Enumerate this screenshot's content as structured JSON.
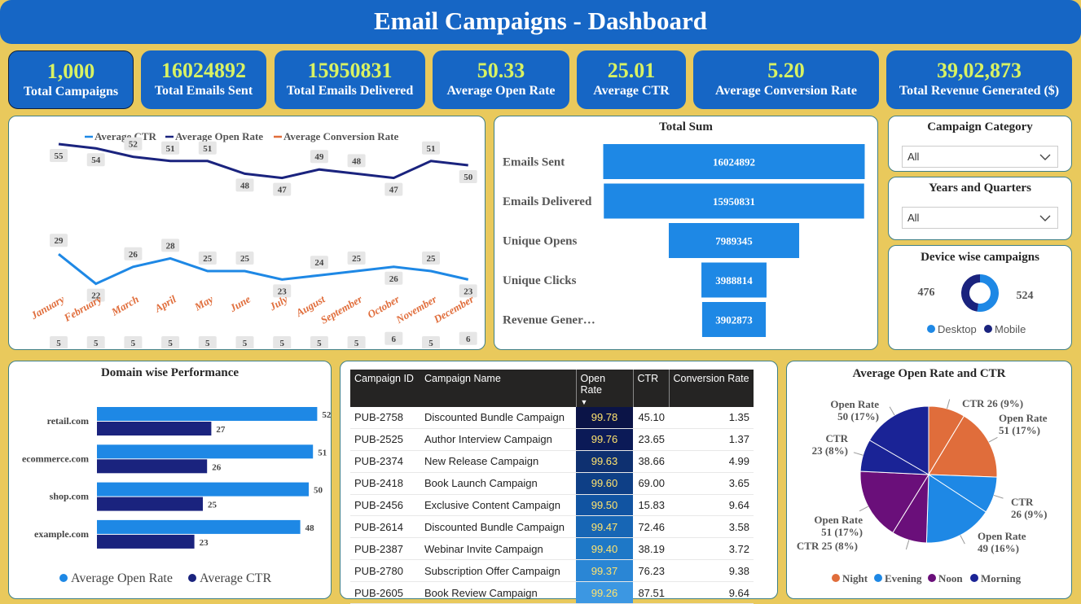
{
  "title": "Email Campaigns - Dashboard",
  "kpis": [
    {
      "value": "1,000",
      "label": "Total Campaigns"
    },
    {
      "value": "16024892",
      "label": "Total Emails Sent"
    },
    {
      "value": "15950831",
      "label": "Total Emails Delivered"
    },
    {
      "value": "50.33",
      "label": "Average Open Rate"
    },
    {
      "value": "25.01",
      "label": "Average CTR"
    },
    {
      "value": "5.20",
      "label": "Average Conversion Rate"
    },
    {
      "value": "39,02,873",
      "label": "Total Revenue Generated ($)"
    }
  ],
  "colors": {
    "primary": "#1666C5",
    "kpi_value": "#D8F263",
    "background": "#E9C95C",
    "ctr": "#1E88E5",
    "open_rate": "#1A237E",
    "conversion": "#E06D3B"
  },
  "chart_data": [
    {
      "type": "line",
      "categories": [
        "January",
        "February",
        "March",
        "April",
        "May",
        "June",
        "July",
        "August",
        "September",
        "October",
        "November",
        "December"
      ],
      "series": [
        {
          "name": "Average CTR",
          "values": [
            29,
            22,
            26,
            28,
            25,
            25,
            23,
            24,
            25,
            26,
            25,
            23
          ]
        },
        {
          "name": "Average Open Rate",
          "values": [
            55,
            54,
            52,
            51,
            51,
            48,
            47,
            49,
            48,
            47,
            51,
            50
          ]
        },
        {
          "name": "Average Conversion Rate",
          "values": [
            5,
            5,
            5,
            5,
            5,
            5,
            5,
            5,
            5,
            6,
            5,
            6
          ]
        }
      ],
      "legend": "top",
      "grid": false
    },
    {
      "type": "bar",
      "title": "Total Sum",
      "categories": [
        "Emails Sent",
        "Emails Delivered",
        "Unique Opens",
        "Unique Clicks",
        "Revenue Gener…"
      ],
      "values": [
        16024892,
        15950831,
        7989345,
        3988814,
        3902873
      ]
    },
    {
      "type": "bar",
      "title": "Domain wise Performance",
      "categories": [
        "retail.com",
        "ecommerce.com",
        "shop.com",
        "example.com"
      ],
      "series": [
        {
          "name": "Average Open Rate",
          "values": [
            52,
            51,
            50,
            48
          ]
        },
        {
          "name": "Average CTR",
          "values": [
            27,
            26,
            25,
            23
          ]
        }
      ],
      "legend": "bottom"
    },
    {
      "type": "pie",
      "title": "Device wise campaigns",
      "categories": [
        "Desktop",
        "Mobile"
      ],
      "values": [
        524,
        476
      ],
      "legend": "bottom"
    },
    {
      "type": "pie",
      "title": "Average Open Rate and CTR",
      "groups": [
        "Night",
        "Evening",
        "Noon",
        "Morning"
      ],
      "slices": [
        {
          "group": "Night",
          "label": "CTR",
          "value": 26,
          "pct": "9%"
        },
        {
          "group": "Night",
          "label": "Open Rate",
          "value": 51,
          "pct": "17%"
        },
        {
          "group": "Evening",
          "label": "CTR",
          "value": 26,
          "pct": "9%"
        },
        {
          "group": "Evening",
          "label": "Open Rate",
          "value": 49,
          "pct": "16%"
        },
        {
          "group": "Noon",
          "label": "CTR",
          "value": 25,
          "pct": "8%"
        },
        {
          "group": "Noon",
          "label": "Open Rate",
          "value": 51,
          "pct": "17%"
        },
        {
          "group": "Morning",
          "label": "CTR",
          "value": 23,
          "pct": "8%"
        },
        {
          "group": "Morning",
          "label": "Open Rate",
          "value": 50,
          "pct": "17%"
        }
      ],
      "legend": "bottom"
    }
  ],
  "slicers": {
    "category": {
      "title": "Campaign Category",
      "value": "All"
    },
    "period": {
      "title": "Years and Quarters",
      "value": "All"
    }
  },
  "device": {
    "title": "Device wise campaigns",
    "mobile": "476",
    "desktop": "524",
    "legend_desktop": "Desktop",
    "legend_mobile": "Mobile"
  },
  "funnel": {
    "title": "Total Sum"
  },
  "domain": {
    "title": "Domain wise Performance",
    "legend_open": "Average Open Rate",
    "legend_ctr": "Average CTR"
  },
  "pie": {
    "title": "Average Open Rate and CTR"
  },
  "table": {
    "headers": [
      "Campaign ID",
      "Campaign Name",
      "Open Rate",
      "CTR",
      "Conversion Rate"
    ],
    "rows": [
      [
        "PUB-2758",
        "Discounted Bundle Campaign",
        "99.78",
        "45.10",
        "1.35"
      ],
      [
        "PUB-2525",
        "Author Interview Campaign",
        "99.76",
        "23.65",
        "1.37"
      ],
      [
        "PUB-2374",
        "New Release Campaign",
        "99.63",
        "38.66",
        "4.99"
      ],
      [
        "PUB-2418",
        "Book Launch Campaign",
        "99.60",
        "69.00",
        "3.65"
      ],
      [
        "PUB-2456",
        "Exclusive Content Campaign",
        "99.50",
        "15.83",
        "9.64"
      ],
      [
        "PUB-2614",
        "Discounted Bundle Campaign",
        "99.47",
        "72.46",
        "3.58"
      ],
      [
        "PUB-2387",
        "Webinar Invite Campaign",
        "99.40",
        "38.19",
        "3.72"
      ],
      [
        "PUB-2780",
        "Subscription Offer Campaign",
        "99.37",
        "76.23",
        "9.38"
      ],
      [
        "PUB-2605",
        "Book Review Campaign",
        "99.26",
        "87.51",
        "9.64"
      ]
    ]
  }
}
